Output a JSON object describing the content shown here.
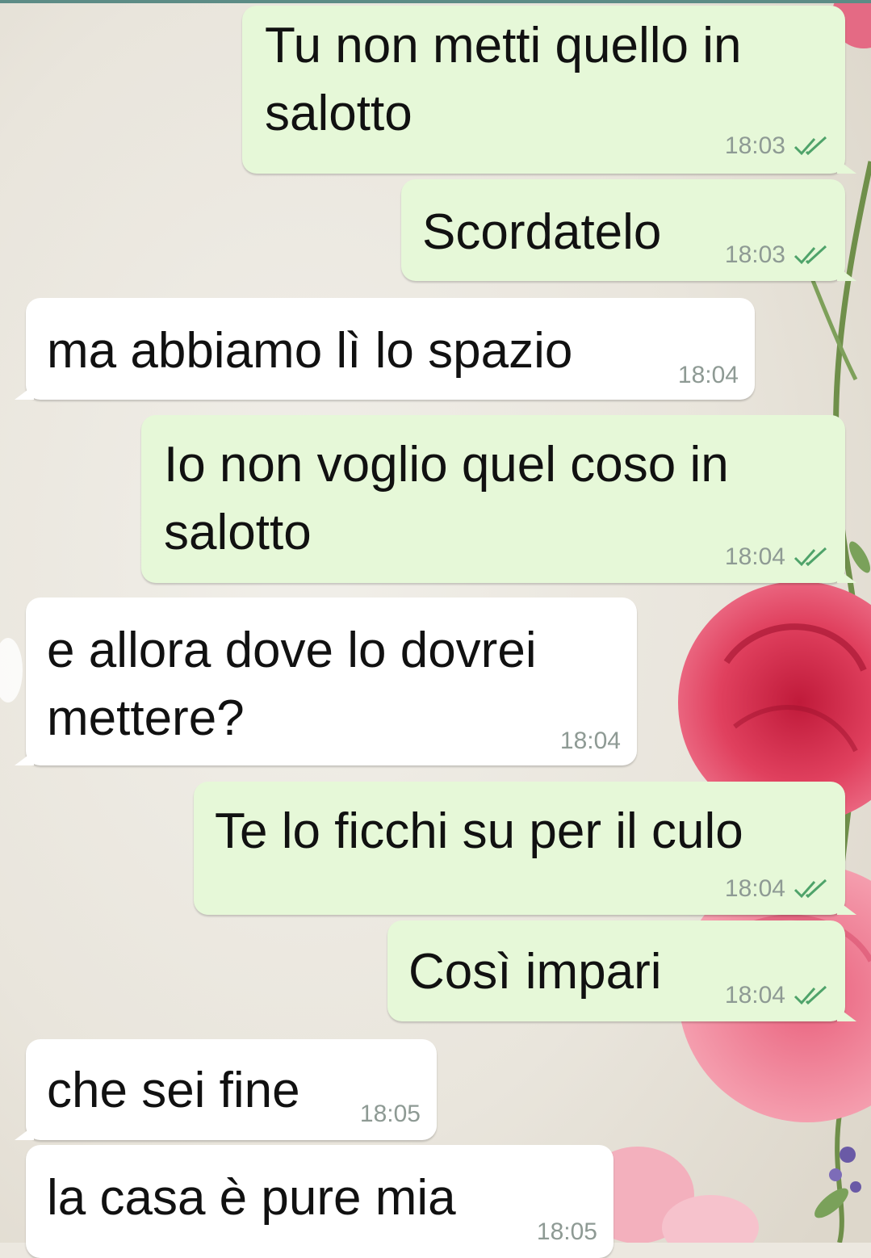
{
  "theme": {
    "outgoing_bubble_color": "#e6f8d8",
    "incoming_bubble_color": "#ffffff",
    "read_tick_color": "#4fa36a",
    "timestamp_color": "#8e9a94"
  },
  "chat": {
    "messages": [
      {
        "direction": "outgoing",
        "text": "Tu non metti quello in\nsalotto",
        "time": "18:03",
        "status_icon": "double-check-read-icon"
      },
      {
        "direction": "outgoing",
        "text": "Scordatelo",
        "time": "18:03",
        "status_icon": "double-check-read-icon"
      },
      {
        "direction": "incoming",
        "text": "ma abbiamo lì lo spazio",
        "time": "18:04"
      },
      {
        "direction": "outgoing",
        "text": "Io non voglio quel coso in\nsalotto",
        "time": "18:04",
        "status_icon": "double-check-read-icon"
      },
      {
        "direction": "incoming",
        "text": "e allora dove lo dovrei\nmettere?",
        "time": "18:04"
      },
      {
        "direction": "outgoing",
        "text": "Te lo ficchi su per il culo",
        "time": "18:04",
        "status_icon": "double-check-read-icon"
      },
      {
        "direction": "outgoing",
        "text": "Così impari",
        "time": "18:04",
        "status_icon": "double-check-read-icon"
      },
      {
        "direction": "incoming",
        "text": "che sei fine",
        "time": "18:05"
      },
      {
        "direction": "incoming",
        "text": "la casa è pure mia",
        "time": "18:05"
      }
    ]
  }
}
